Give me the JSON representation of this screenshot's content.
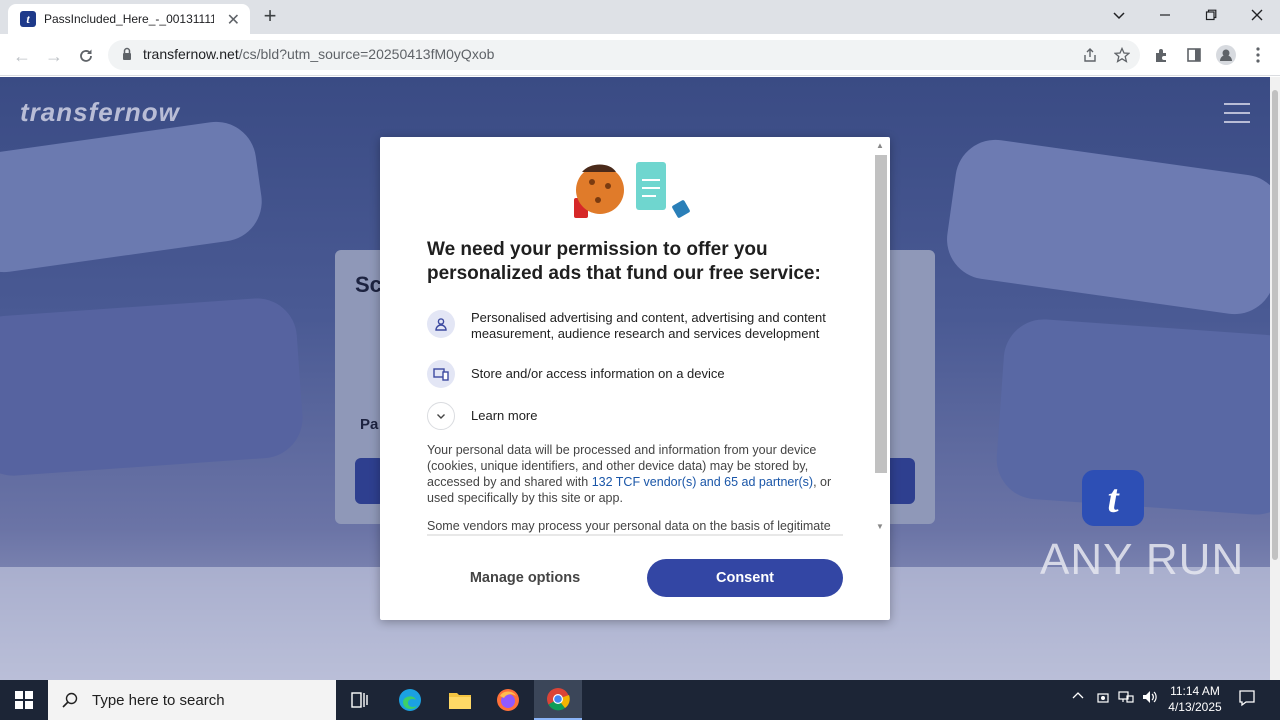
{
  "browser": {
    "tab_title": "PassIncluded_Here_-_00131111_",
    "tab_favicon": "t",
    "url_host": "transfernow.net",
    "url_path": "/cs/bld?utm_source=20250413fM0yQxob"
  },
  "page": {
    "logo": "transfernow",
    "bg_heading": "Sc",
    "bg_label": "Pa",
    "badge": "t"
  },
  "modal": {
    "title": "We need your permission to offer you personalized ads that fund our free service:",
    "purposes": [
      {
        "icon": "person-icon",
        "text": "Personalised advertising and content, advertising and content measurement, audience research and services development"
      },
      {
        "icon": "device-icon",
        "text": "Store and/or access information on a device"
      },
      {
        "icon": "chevron-down-icon",
        "text": "Learn more"
      }
    ],
    "body_before": "Your personal data will be processed and information from your device (cookies, unique identifiers, and other device data) may be stored by, accessed by and shared with ",
    "body_link": "132 TCF vendor(s) and 65 ad partner(s)",
    "body_after": ", or used specifically by this site or app.",
    "body2": "Some vendors may process your personal data on the basis of legitimate",
    "manage_label": "Manage options",
    "consent_label": "Consent",
    "consent_color": "#3346a4"
  },
  "watermark": "ANY RUN",
  "taskbar": {
    "search_placeholder": "Type here to search",
    "time": "11:14 AM",
    "date": "4/13/2025"
  }
}
